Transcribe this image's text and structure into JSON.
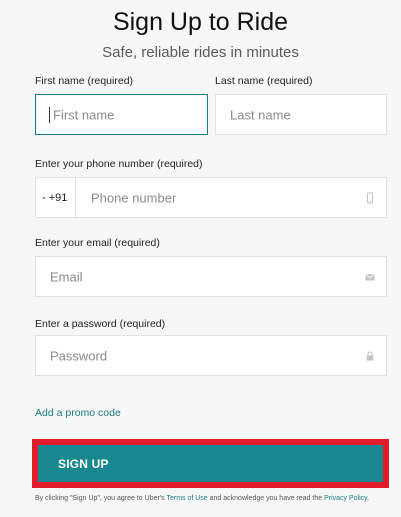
{
  "header": {
    "title": "Sign Up to Ride",
    "subtitle": "Safe, reliable rides in minutes"
  },
  "form": {
    "first_name": {
      "label": "First name (required)",
      "placeholder": "First name",
      "value": ""
    },
    "last_name": {
      "label": "Last name (required)",
      "placeholder": "Last name",
      "value": ""
    },
    "phone": {
      "label": "Enter your phone number (required)",
      "country_code": "- +91",
      "placeholder": "Phone number",
      "value": "",
      "icon": "phone-icon"
    },
    "email": {
      "label": "Enter your email (required)",
      "placeholder": "Email",
      "value": "",
      "icon": "envelope-icon"
    },
    "password": {
      "label": "Enter a password (required)",
      "placeholder": "Password",
      "value": "",
      "icon": "lock-icon"
    }
  },
  "promo_link": "Add a promo code",
  "signup_button": "SIGN UP",
  "legal": {
    "prefix": "By clicking \"Sign Up\", you agree to Uber's ",
    "terms_link": "Terms of Use",
    "middle": " and acknowledge you have read the ",
    "privacy_link": "Privacy Policy",
    "suffix": "."
  },
  "colors": {
    "accent": "#18878f",
    "highlight_border": "#e31b2a",
    "background": "#f7f7f7"
  }
}
